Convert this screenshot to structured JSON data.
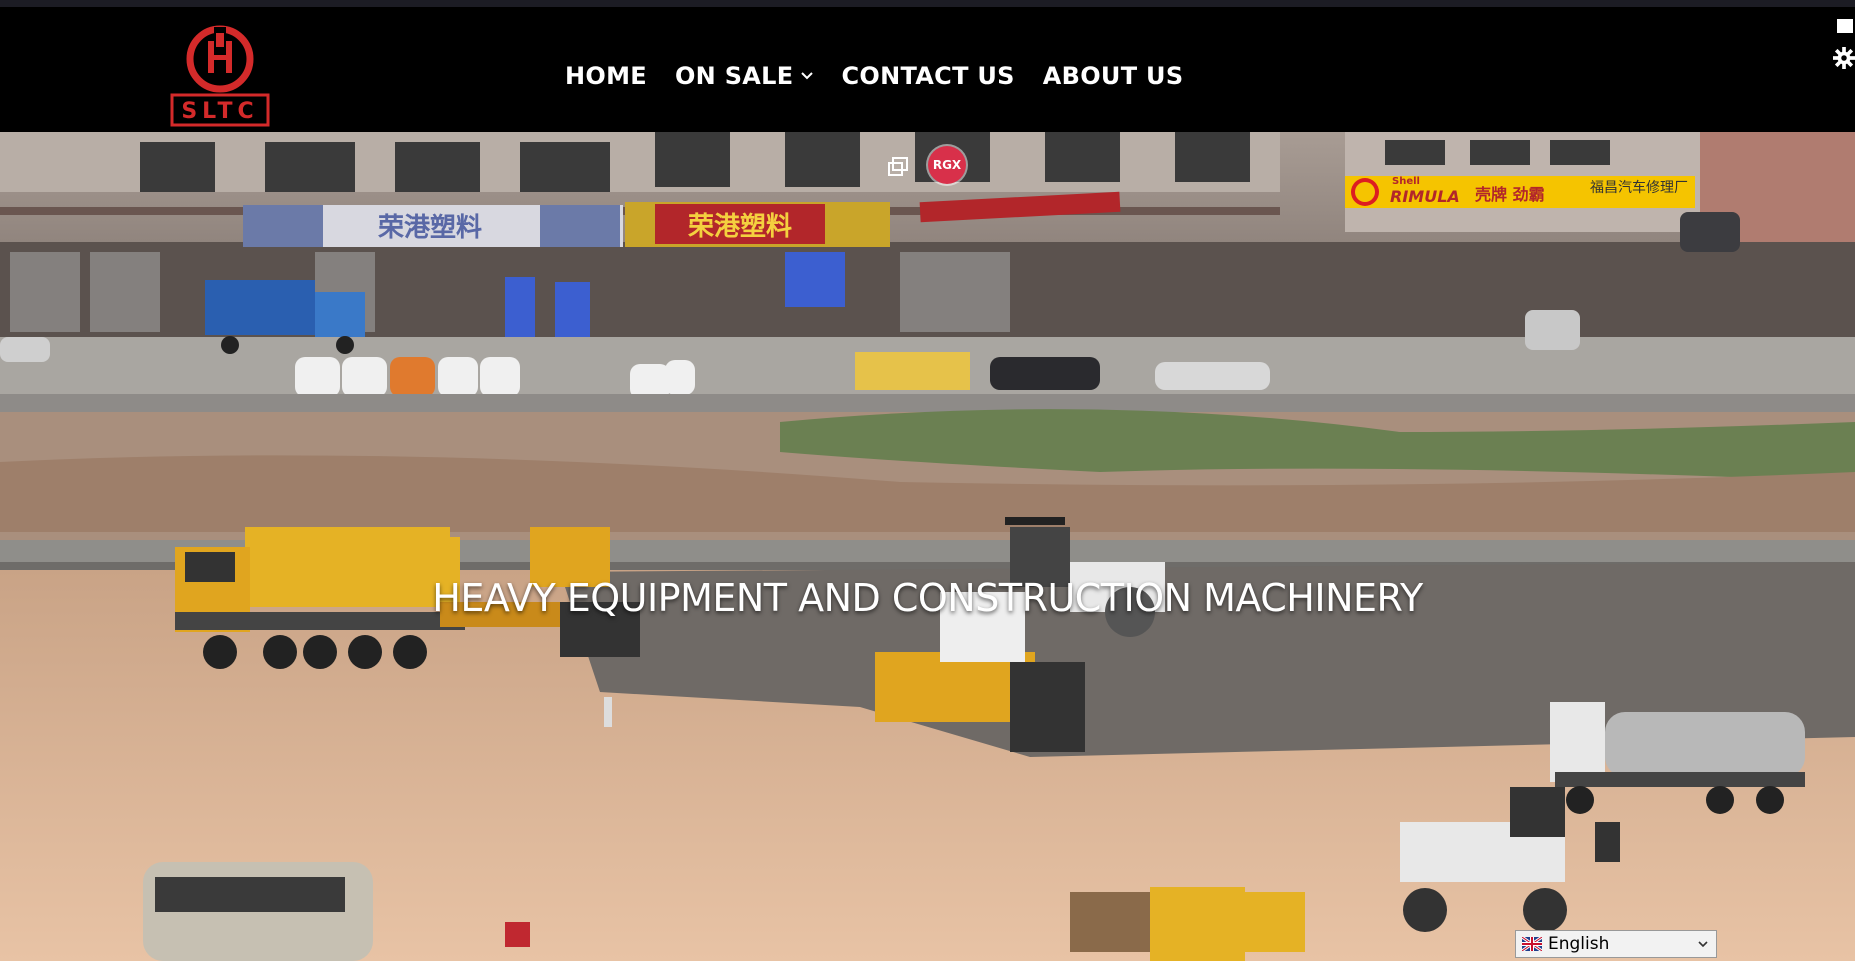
{
  "brand": {
    "logo_text": "SLTC",
    "logo_color": "#d42a2a"
  },
  "nav": {
    "items": [
      {
        "label": "HOME"
      },
      {
        "label": "ON SALE"
      },
      {
        "label": "CONTACT US"
      },
      {
        "label": "ABOUT US"
      }
    ]
  },
  "hero": {
    "title": "HEAVY EQUIPMENT AND CONSTRUCTION MACHINERY",
    "badge": "RGX",
    "signs": {
      "shop1": "荣港塑料",
      "shop2": "荣港塑料",
      "shell_brand": "Shell",
      "shell_product": "RIMULA",
      "shell_cn": "壳牌 劲霸",
      "garage": "福昌汽车修理厂"
    }
  },
  "language": {
    "selected": "English"
  },
  "icons": [
    "logo-emblem",
    "chevron-down-icon",
    "square-icon",
    "gear-icon",
    "picture-in-picture-icon",
    "uk-flag-icon",
    "caret-down-icon"
  ]
}
